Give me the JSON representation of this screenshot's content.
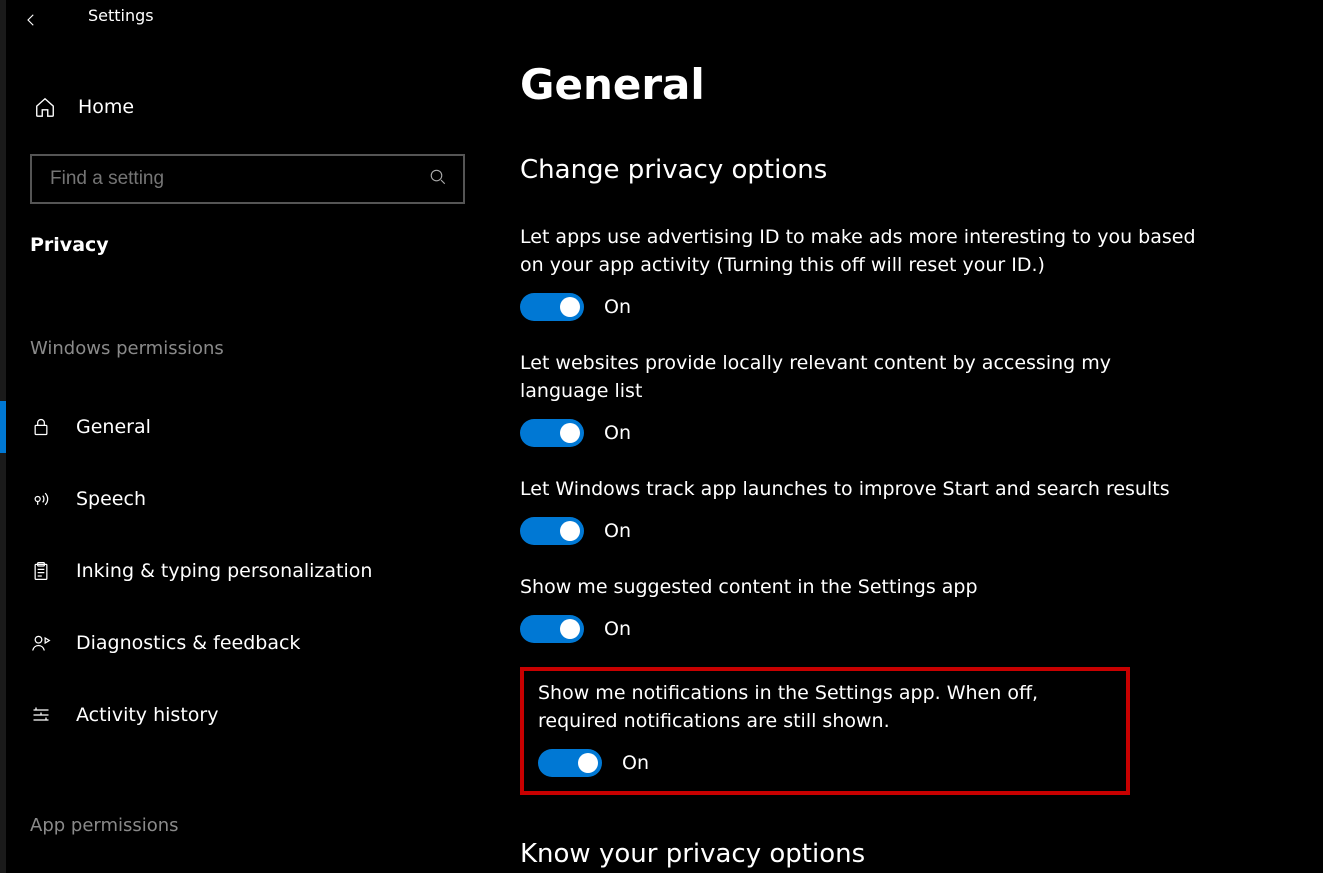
{
  "app_title": "Settings",
  "sidebar": {
    "home_label": "Home",
    "search_placeholder": "Find a setting",
    "section_label": "Privacy",
    "group1_label": "Windows permissions",
    "group2_label": "App permissions",
    "items": [
      {
        "label": "General"
      },
      {
        "label": "Speech"
      },
      {
        "label": "Inking & typing personalization"
      },
      {
        "label": "Diagnostics & feedback"
      },
      {
        "label": "Activity history"
      }
    ]
  },
  "main": {
    "page_title": "General",
    "subheading1": "Change privacy options",
    "settings": [
      {
        "label": "Let apps use advertising ID to make ads more interesting to you based on your app activity (Turning this off will reset your ID.)",
        "state": "On"
      },
      {
        "label": "Let websites provide locally relevant content by accessing my language list",
        "state": "On"
      },
      {
        "label": "Let Windows track app launches to improve Start and search results",
        "state": "On"
      },
      {
        "label": "Show me suggested content in the Settings app",
        "state": "On"
      },
      {
        "label": "Show me notifications in the Settings app. When off, required notifications are still shown.",
        "state": "On"
      }
    ],
    "subheading2": "Know your privacy options"
  }
}
